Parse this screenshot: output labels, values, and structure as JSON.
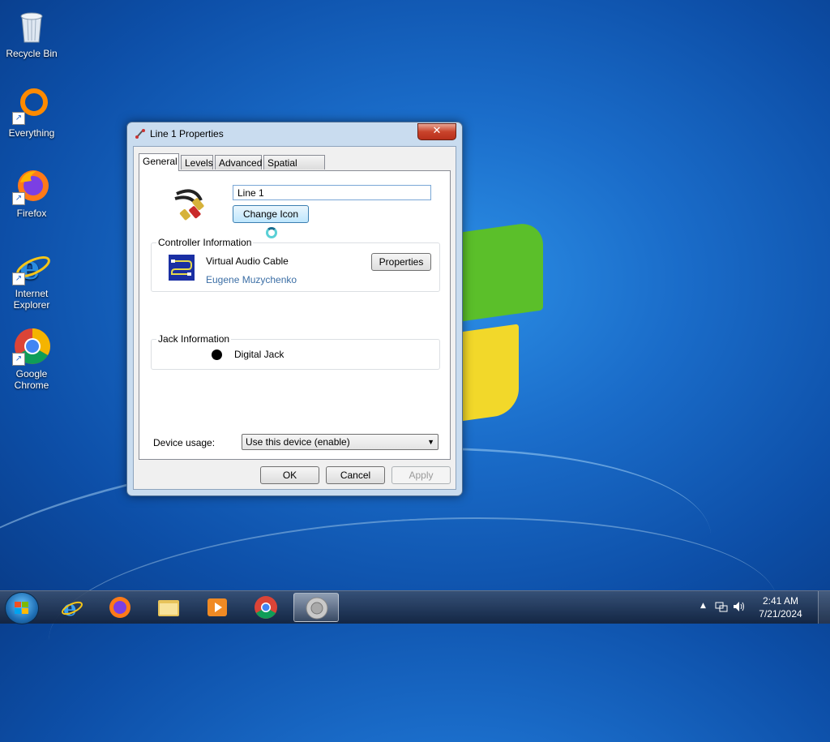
{
  "desktop": {
    "icons": [
      {
        "label": "Recycle Bin",
        "icon": "recycle-bin-icon"
      },
      {
        "label": "Everything",
        "icon": "everything-icon"
      },
      {
        "label": "Firefox",
        "icon": "firefox-icon"
      },
      {
        "label": "Internet Explorer",
        "icon": "internet-explorer-icon"
      },
      {
        "label": "Google Chrome",
        "icon": "chrome-icon"
      }
    ]
  },
  "dialog": {
    "title": "Line 1 Properties",
    "close_label": "✕",
    "tabs": [
      {
        "label": "General",
        "active": true
      },
      {
        "label": "Levels",
        "active": false
      },
      {
        "label": "Advanced",
        "active": false
      },
      {
        "label": "Spatial sound",
        "active": false
      }
    ],
    "general": {
      "device_name": "Line 1",
      "change_icon_label": "Change Icon",
      "controller": {
        "title": "Controller Information",
        "name": "Virtual Audio Cable",
        "vendor": "Eugene Muzychenko",
        "properties_label": "Properties"
      },
      "jack": {
        "title": "Jack Information",
        "name": "Digital Jack"
      },
      "device_usage": {
        "label": "Device usage:",
        "selected": "Use this device (enable)"
      }
    },
    "buttons": {
      "ok": "OK",
      "cancel": "Cancel",
      "apply": "Apply"
    }
  },
  "taskbar": {
    "pinned": [
      "internet-explorer-icon",
      "firefox-icon",
      "file-explorer-icon",
      "media-player-icon",
      "chrome-icon",
      "speaker-icon"
    ],
    "time": "2:41 AM",
    "date": "7/21/2024"
  },
  "colors": {
    "accent": "#3c7fb1",
    "close_button": "#c9432b",
    "link": "#3b6ea5"
  }
}
